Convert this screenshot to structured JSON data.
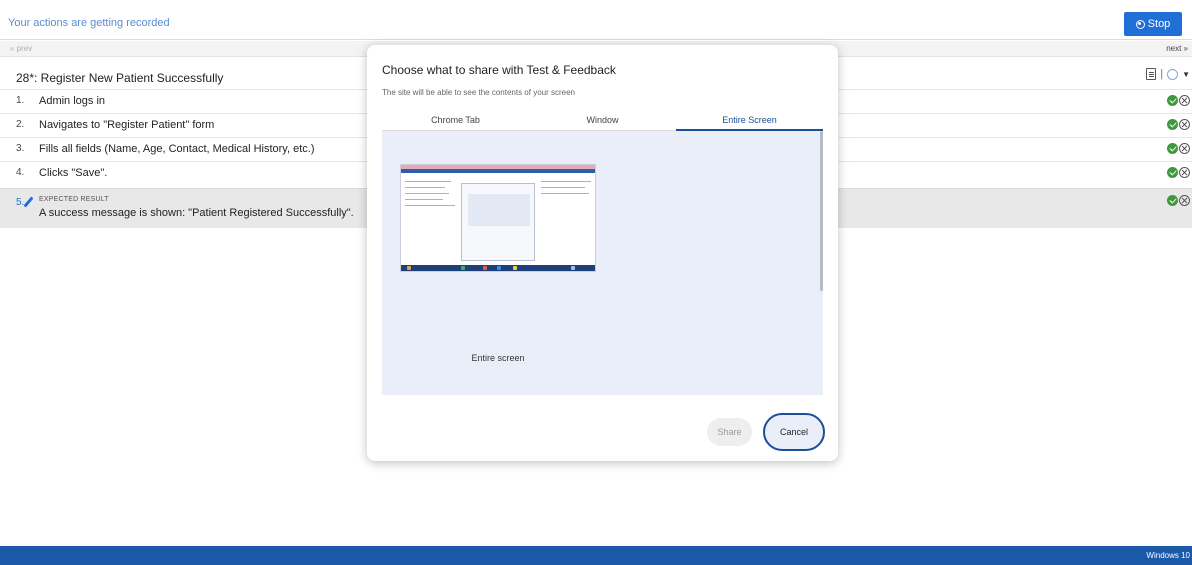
{
  "recorder": {
    "status_text": "Your actions are getting recorded",
    "stop_label": "Stop"
  },
  "nav": {
    "prev_label": "« prev",
    "next_label": "next »"
  },
  "test_case": {
    "title": "28*: Register New Patient Successfully",
    "steps": [
      {
        "num": "1.",
        "text": "Admin logs in"
      },
      {
        "num": "2.",
        "text": "Navigates to \"Register Patient\" form"
      },
      {
        "num": "3.",
        "text": "Fills all fields (Name, Age, Contact, Medical History, etc.)"
      },
      {
        "num": "4.",
        "text": "Clicks \"Save\"."
      }
    ],
    "expected": {
      "num": "5.",
      "label": "EXPECTED RESULT",
      "text": "A success message is shown: \"Patient Registered Successfully\"."
    }
  },
  "dialog": {
    "title": "Choose what to share with Test & Feedback",
    "subtitle": "The site will be able to see the contents of your screen",
    "tabs": [
      {
        "label": "Chrome Tab"
      },
      {
        "label": "Window"
      },
      {
        "label": "Entire Screen"
      }
    ],
    "active_tab": "Entire Screen",
    "thumbnail_label": "Entire screen",
    "share_label": "Share",
    "cancel_label": "Cancel"
  },
  "footer": {
    "text": "Windows 10"
  },
  "icons": {
    "stop": "record-stop-icon",
    "doc": "document-icon",
    "status_pass": "check-circle-icon",
    "status_fail": "x-circle-icon",
    "edit": "pencil-icon"
  },
  "colors": {
    "accent": "#1f6fd6",
    "tab_active": "#1a4f9c",
    "pass": "#3c9a3c",
    "footer": "#1a5aa8"
  }
}
